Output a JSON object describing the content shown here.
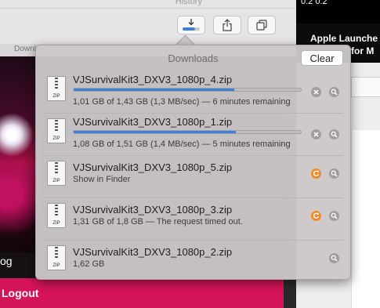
{
  "background": {
    "history_label": "History",
    "tab_label": "Downlo",
    "right_sliver_text": "0:2 0:2",
    "right_title_line1": "Apple Launche",
    "right_title_line2": "for M",
    "side_text_og": "og",
    "side_text_logout": "Logout"
  },
  "toolbar": {
    "download_button_icon": "download-arrow-icon",
    "share_button_icon": "share-icon",
    "tabs_button_icon": "tabs-overview-icon",
    "download_progress": 0.72,
    "accent_color": "#3f7fd9"
  },
  "downloads": {
    "title": "Downloads",
    "clear_label": "Clear",
    "items": [
      {
        "name": "VJSurvivalKit3_DXV3_1080p_4.zip",
        "status": "1,01 GB of 1,43 GB (1,3 MB/sec) — 6 minutes remaining",
        "state": "downloading",
        "progress": 0.706,
        "icon": "zip-file-icon",
        "icon_label": "ZIP"
      },
      {
        "name": "VJSurvivalKit3_DXV3_1080p_1.zip",
        "status": "1,08 GB of 1,51 GB (1,4 MB/sec) — 5 minutes remaining",
        "state": "downloading",
        "progress": 0.715,
        "icon": "zip-file-icon",
        "icon_label": "ZIP"
      },
      {
        "name": "VJSurvivalKit3_DXV3_1080p_5.zip",
        "status": "Show in Finder",
        "state": "stopped",
        "icon": "zip-file-icon",
        "icon_label": "ZIP"
      },
      {
        "name": "VJSurvivalKit3_DXV3_1080p_3.zip",
        "status": "1,31 GB of 1,8 GB — The request timed out.",
        "state": "failed",
        "icon": "zip-file-icon",
        "icon_label": "ZIP"
      },
      {
        "name": "VJSurvivalKit3_DXV3_1080p_2.zip",
        "status": "1,62 GB",
        "state": "complete",
        "icon": "zip-file-icon",
        "icon_label": "ZIP"
      }
    ]
  }
}
